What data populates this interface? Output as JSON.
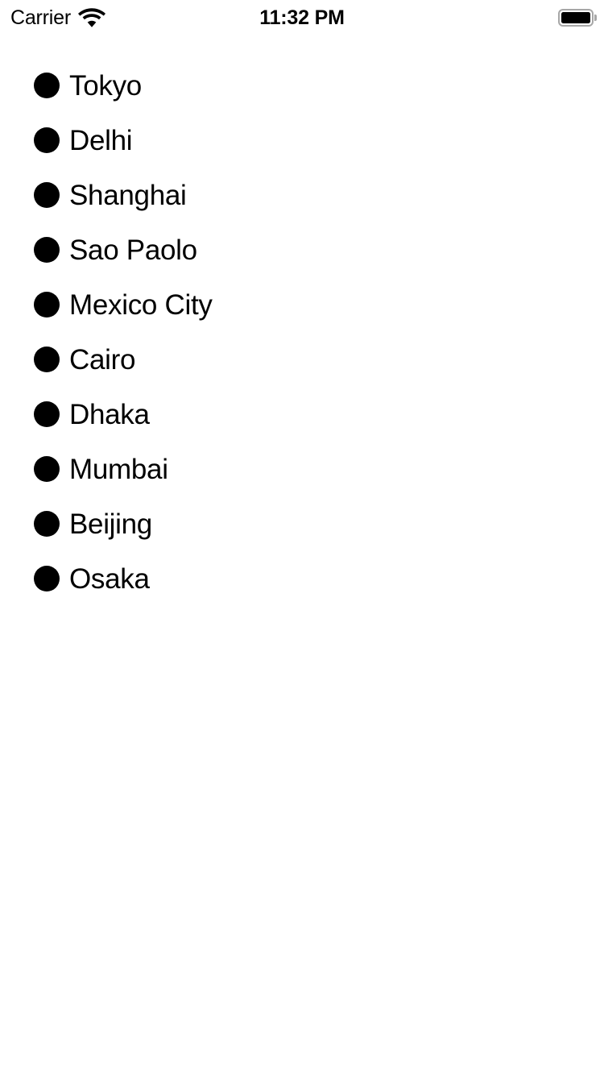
{
  "status_bar": {
    "carrier": "Carrier",
    "wifi_icon": "wifi-icon",
    "time": "11:32 PM",
    "battery_icon": "battery-full-icon",
    "battery_level_percent": 100,
    "colors": {
      "text": "#000000",
      "battery_outline": "#a7a7a7",
      "background": "#ffffff"
    }
  },
  "main": {
    "background_color": "#ffffff",
    "list": {
      "bullet_icon": "bullet-dot-icon",
      "bullet_color": "#000000",
      "items": [
        {
          "label": "Tokyo"
        },
        {
          "label": "Delhi"
        },
        {
          "label": "Shanghai"
        },
        {
          "label": "Sao Paolo"
        },
        {
          "label": "Mexico City"
        },
        {
          "label": "Cairo"
        },
        {
          "label": "Dhaka"
        },
        {
          "label": "Mumbai"
        },
        {
          "label": "Beijing"
        },
        {
          "label": "Osaka"
        }
      ]
    }
  }
}
